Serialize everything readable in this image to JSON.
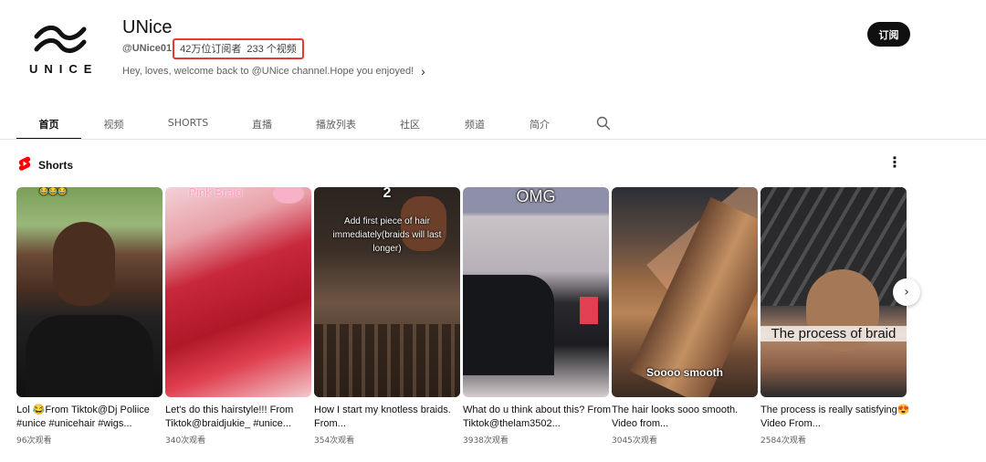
{
  "channel": {
    "logo_text": "UNICE",
    "name": "UNice",
    "handle": "@UNice01",
    "subscribers": "42万位订阅者",
    "video_count": "233 个视频",
    "description": "Hey, loves, welcome back to @UNice channel.Hope you enjoyed!",
    "subscribe_label": "订阅"
  },
  "tabs": [
    {
      "label": "首页",
      "active": true
    },
    {
      "label": "视频"
    },
    {
      "label": "SHORTS"
    },
    {
      "label": "直播"
    },
    {
      "label": "播放列表"
    },
    {
      "label": "社区"
    },
    {
      "label": "频道"
    },
    {
      "label": "简介"
    }
  ],
  "shorts": {
    "title": "Shorts",
    "items": [
      {
        "title": "Lol 😂From Tiktok@Dj Poliice #unice #unicehair #wigs...",
        "views": "96次观看",
        "overlay": "😂😂😂"
      },
      {
        "title": "Let's do this hairstyle!!! From Tiktok@braidjukie_ #unice...",
        "views": "340次观看",
        "overlay": "Pink Braid"
      },
      {
        "title": "How I start my knotless braids. From...",
        "views": "354次观看",
        "overlay": "2",
        "overlay2": "Add first piece of hair immediately(braids will last longer)"
      },
      {
        "title": "What do u think about this? From Tiktok@thelam3502...",
        "views": "3938次观看",
        "overlay": "OMG"
      },
      {
        "title": "The hair looks sooo smooth. Video from...",
        "views": "3045次观看",
        "overlay": "Soooo smooth"
      },
      {
        "title": "The process is really satisfying😍 Video From...",
        "views": "2584次观看",
        "overlay": "The process of braid"
      }
    ]
  },
  "colors": {
    "highlight_border": "#e53935",
    "shorts_red": "#ff0000",
    "text_primary": "#0f0f0f",
    "text_secondary": "#606060"
  }
}
